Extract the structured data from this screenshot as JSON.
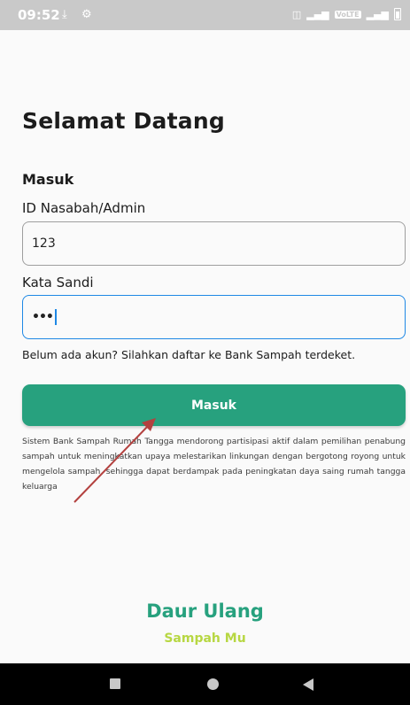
{
  "status_bar": {
    "time": "09:52",
    "icons": [
      "download-icon",
      "gear-icon"
    ],
    "right_icons": [
      "vibrate-icon",
      "signal-icon",
      "volte-badge",
      "signal-4g-icon",
      "battery-icon"
    ],
    "volte_label": "VoLTE"
  },
  "login": {
    "title": "Selamat Datang",
    "section": "Masuk",
    "id_label": "ID Nasabah/Admin",
    "id_value": "123",
    "password_label": "Kata Sandi",
    "password_value": "•••",
    "hint": "Belum ada akun? Silahkan daftar ke Bank Sampah terdeket.",
    "submit_label": "Masuk",
    "description": "Sistem Bank Sampah Rumah Tangga mendorong partisipasi aktif dalam pemilihan penabung sampah untuk meningkatkan upaya melestarikan linkungan dengan bergotong royong untuk mengelola sampah, sehingga dapat berdampak pada peningkatan daya saing rumah tangga keluarga"
  },
  "brand": {
    "line1": "Daur Ulang",
    "line2": "Sampah Mu"
  },
  "colors": {
    "primary": "#27a17e",
    "accent": "#b7d742",
    "focus": "#1e88e5",
    "annotation_arrow": "#b3413f"
  },
  "nav_bar": {
    "icons": [
      "recent-apps-icon",
      "home-icon",
      "back-icon"
    ]
  }
}
